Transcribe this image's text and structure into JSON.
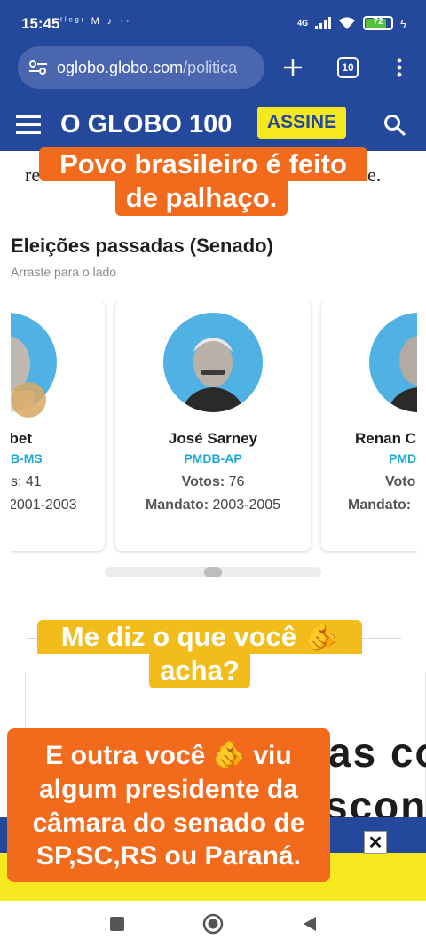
{
  "status_bar": {
    "time": "15:45",
    "notifications": "ᴵˡᵉᵍᶦ M ♪ ··",
    "network": "4G",
    "battery_level": "72"
  },
  "browser": {
    "url_domain": "oglobo.globo.com",
    "url_path": "/politica",
    "tabs_count": "10"
  },
  "site": {
    "logo": "O GLOBO 100",
    "subscribe_label": "ASSINE"
  },
  "article": {
    "fragment_left": "re",
    "fragment_right": "e."
  },
  "section": {
    "title": "Eleições passadas (Senado)",
    "subtitle": "Arraste para o lado"
  },
  "cards": [
    {
      "name": "Tebet",
      "party": "B-MS",
      "votes_label": "s:",
      "votes": "41",
      "term": "2001-2003"
    },
    {
      "name": "José Sarney",
      "party": "PMDB-AP",
      "votes_label": "Votos:",
      "votes": "76",
      "term_label": "Mandato:",
      "term": "2003-2005"
    },
    {
      "name": "Renan C",
      "party": "PMD",
      "votes_label": "Voto",
      "term_label": "Mandato:"
    }
  ],
  "ad": {
    "line1": "as co",
    "line2": "scon"
  },
  "captions": {
    "top": [
      "Povo brasileiro é feito",
      "de palhaço."
    ],
    "middle": [
      "Me diz o que você 🫵",
      "acha?"
    ],
    "bottom": [
      "E outra você 🫵 viu",
      "algum presidente da",
      "câmara do senado de",
      "SP,SC,RS ou Paraná."
    ]
  },
  "colors": {
    "brand_blue": "#23489c",
    "assine_yellow": "#f6e81f",
    "caption_orange": "#f26a1b",
    "caption_yellow": "#f2bd1b",
    "party_cyan": "#18a8d8"
  }
}
